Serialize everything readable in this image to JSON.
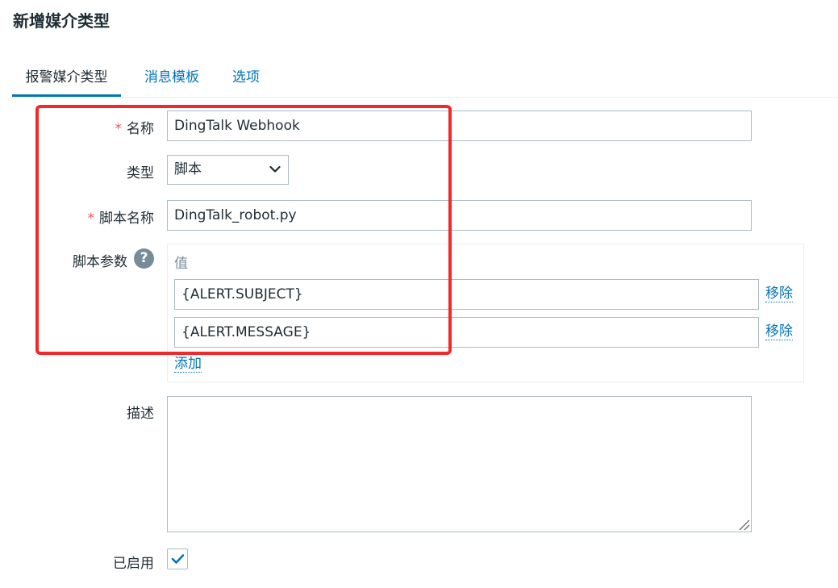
{
  "page": {
    "title": "新增媒介类型"
  },
  "tabs": [
    {
      "label": "报警媒介类型",
      "active": true
    },
    {
      "label": "消息模板",
      "active": false
    },
    {
      "label": "选项",
      "active": false
    }
  ],
  "form": {
    "name": {
      "label": "名称",
      "required_mark": "*",
      "value": "DingTalk Webhook"
    },
    "type": {
      "label": "类型",
      "value": "脚本",
      "options": [
        "脚本"
      ]
    },
    "script_name": {
      "label": "脚本名称",
      "required_mark": "*",
      "value": "DingTalk_robot.py"
    },
    "script_params": {
      "label": "脚本参数",
      "help_icon": "?",
      "column_header": "值",
      "rows": [
        {
          "value": "{ALERT.SUBJECT}",
          "remove_label": "移除"
        },
        {
          "value": "{ALERT.MESSAGE}",
          "remove_label": "移除"
        }
      ],
      "add_label": "添加"
    },
    "description": {
      "label": "描述",
      "value": ""
    },
    "enabled": {
      "label": "已启用",
      "checked": true
    }
  },
  "icons": {
    "type_dropdown": "chevron-down-icon",
    "help": "question-circle-icon",
    "enabled": "checkmark-icon",
    "textarea_resize": "resize-grip-icon"
  },
  "colors": {
    "link": "#0275b8",
    "required": "#e45959",
    "highlight_box": "#f2282a",
    "input_border": "#acbbc2",
    "muted_text": "#768d99"
  }
}
